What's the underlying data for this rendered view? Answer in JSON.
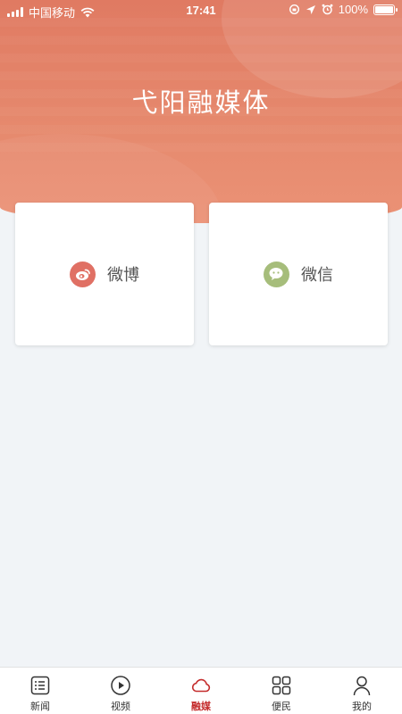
{
  "status_bar": {
    "carrier": "中国移动",
    "time": "17:41",
    "battery": "100%"
  },
  "header": {
    "title": "弋阳融媒体"
  },
  "cards": [
    {
      "label": "微博",
      "icon": "weibo-icon"
    },
    {
      "label": "微信",
      "icon": "wechat-icon"
    }
  ],
  "tabbar": {
    "items": [
      {
        "label": "新闻",
        "icon": "news-list-icon"
      },
      {
        "label": "视频",
        "icon": "play-icon"
      },
      {
        "label": "融媒",
        "icon": "cloud-icon",
        "active": true
      },
      {
        "label": "便民",
        "icon": "grid-icon"
      },
      {
        "label": "我的",
        "icon": "user-icon"
      }
    ]
  },
  "colors": {
    "header": "#e68a6e",
    "weibo": "#e07064",
    "wechat": "#a6bd7b",
    "active_tab": "#c42c2c",
    "background": "#f1f4f7"
  }
}
